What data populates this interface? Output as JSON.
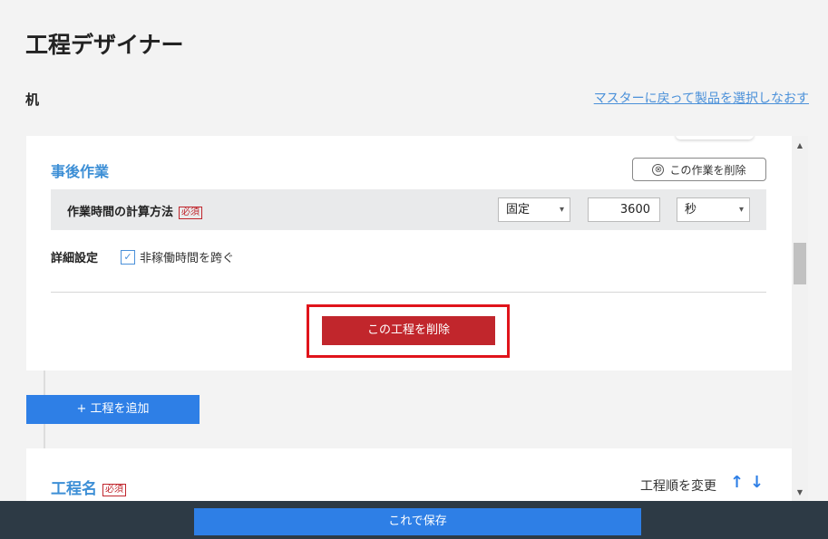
{
  "header": {
    "title": "工程デザイナー",
    "product_name": "机",
    "back_link": "マスターに戻って製品を選択しなおす"
  },
  "task_section": {
    "title": "事後作業",
    "delete_task_button": "この作業を削除",
    "calc_label": "作業時間の計算方法",
    "required_badge": "必須",
    "method_value": "固定",
    "seconds_value": "3600",
    "unit_value": "秒",
    "detail_label": "詳細設定",
    "checkbox_label": "非稼働時間を跨ぐ",
    "checkbox_checked": true,
    "delete_process_button": "この工程を削除"
  },
  "add_process_button": "+ 工程を追加",
  "process_card": {
    "name_label": "工程名",
    "required_badge": "必須",
    "order_label": "工程順を変更",
    "up_arrow": "↑",
    "down_arrow": "↓"
  },
  "footer": {
    "save_button": "これで保存"
  },
  "icons": {
    "x_circle": "⊗",
    "checkmark": "✓",
    "chevron": "▾",
    "scroll_up": "▲",
    "scroll_down": "▼"
  },
  "colors": {
    "accent_blue": "#2e7fe6",
    "title_blue": "#3d8fd6",
    "danger_red": "#c1262c",
    "highlight_red": "#e0141b",
    "footer_bg": "#2d3a45"
  }
}
